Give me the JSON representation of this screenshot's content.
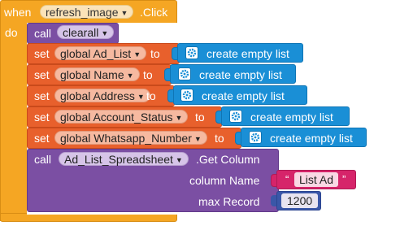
{
  "event": {
    "when_label": "when",
    "component": "refresh_image",
    "event_name": ".Click",
    "do_label": "do"
  },
  "call_clearall": {
    "call_label": "call",
    "procedure": "clearall"
  },
  "set_blocks": [
    {
      "set_label": "set",
      "variable": "global Ad_List",
      "to_label": "to",
      "value": "create empty list"
    },
    {
      "set_label": "set",
      "variable": "global Name",
      "to_label": "to",
      "value": "create empty list"
    },
    {
      "set_label": "set",
      "variable": "global Address",
      "to_label": "to",
      "value": "create empty list"
    },
    {
      "set_label": "set",
      "variable": "global Account_Status",
      "to_label": "to",
      "value": "create empty list"
    },
    {
      "set_label": "set",
      "variable": "global Whatsapp_Number",
      "to_label": "to",
      "value": "create empty list"
    }
  ],
  "get_column": {
    "call_label": "call",
    "component": "Ad_List_Spreadsheet",
    "method": ".Get Column",
    "column_name_label": "column Name",
    "column_name_value": "List Ad",
    "quote_open": "“",
    "quote_close": "”",
    "max_record_label": "max Record",
    "max_record_value": "1200"
  },
  "colors": {
    "event": "#f5a623",
    "procedure": "#7b4fa3",
    "set": "#e8602c",
    "list": "#1a8fd6",
    "text": "#d6246a"
  }
}
